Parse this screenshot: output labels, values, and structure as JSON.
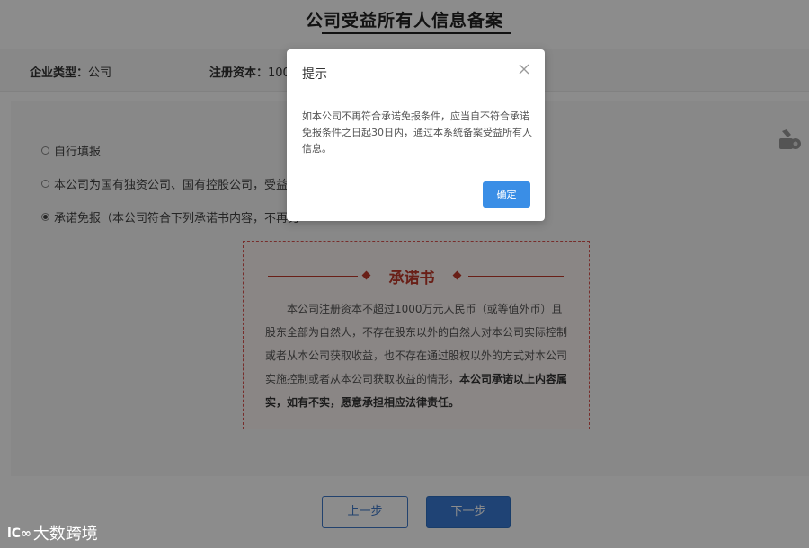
{
  "page": {
    "title": "公司受益所有人信息备案"
  },
  "info_bar": {
    "company_type_label": "企业类型：",
    "company_type_value": "公司",
    "registered_capital_label": "注册资本：",
    "registered_capital_value": "100"
  },
  "options": [
    {
      "label": "自行填报",
      "selected": false
    },
    {
      "label": "本公司为国有独资公司、国有控股公司，受益所",
      "selected": false
    },
    {
      "label": "承诺免报（本公司符合下列承诺书内容，不再另",
      "selected": true
    }
  ],
  "pledge": {
    "title": "承诺书",
    "body": "本公司注册资本不超过1000万元人民币（或等值外币）且股东全部为自然人，不存在股东以外的自然人对本公司实际控制或者从本公司获取收益，也不存在通过股权以外的方式对本公司实施控制或者从本公司获取收益的情形，",
    "body_bold": "本公司承诺以上内容属实，如有不实，愿意承担相应法律责任。"
  },
  "buttons": {
    "prev": "上一步",
    "next": "下一步"
  },
  "dialog": {
    "title": "提示",
    "message": "如本公司不再符合承诺免报条件，应当自不符合承诺免报条件之日起30日内，通过本系统备案受益所有人信息。",
    "confirm": "确定",
    "close_icon": "close-icon"
  },
  "watermark": {
    "logo": "lC∞",
    "text": "大数跨境"
  },
  "colors": {
    "primary": "#3a7bd5",
    "pledge_red": "#c0392b",
    "dialog_button": "#3a8ee6"
  }
}
